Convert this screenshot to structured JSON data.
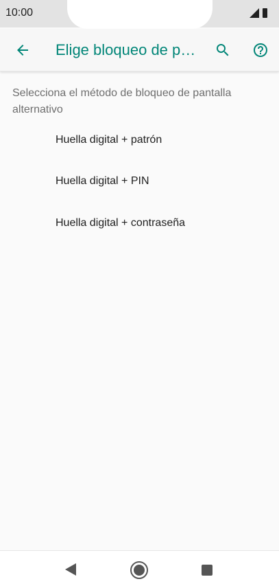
{
  "status_bar": {
    "time": "10:00"
  },
  "app_bar": {
    "title": "Elige bloqueo de p…",
    "accent_color": "#008577",
    "icons": [
      "arrow-back-icon",
      "search-icon",
      "help-icon"
    ]
  },
  "content": {
    "description": "Selecciona el método de bloqueo de pantalla alternativo",
    "options": [
      {
        "label": "Huella digital + patrón"
      },
      {
        "label": "Huella digital + PIN"
      },
      {
        "label": "Huella digital + contraseña"
      }
    ]
  },
  "nav_bar": {
    "icons": [
      "nav-back-icon",
      "nav-home-icon",
      "nav-recents-icon"
    ]
  }
}
